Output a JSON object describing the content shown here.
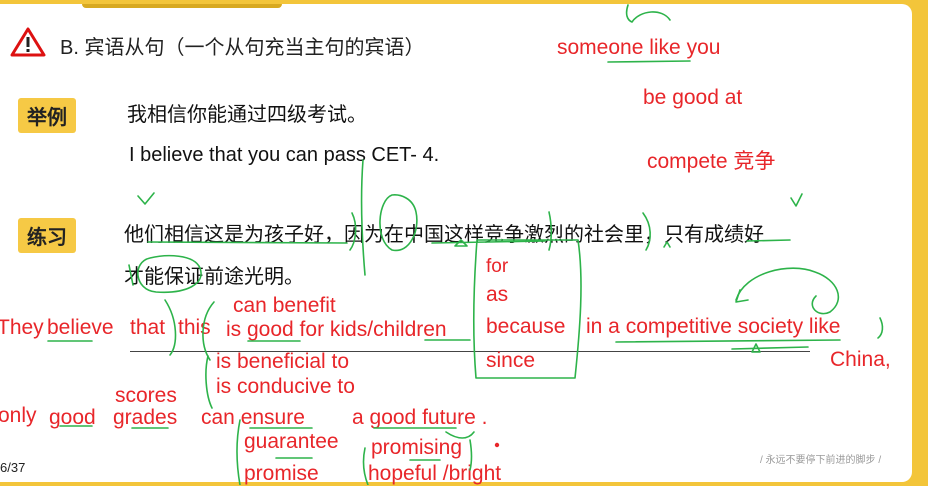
{
  "slide": {
    "heading": "B. 宾语从句（一个从句充当主句的宾语）",
    "example_tag": "举例",
    "example_cn": "我相信你能通过四级考试。",
    "example_en": "I believe that you can pass CET- 4.",
    "practice_tag": "练习",
    "practice_cn_line1": "他们相信这是为孩子好，因为在中国这样竞争激烈的社会里，只有成绩好",
    "practice_cn_line2": "才能保证前途光明。",
    "page_number": "6/37",
    "footer": "/ 永远不要停下前进的脚步 /"
  },
  "annotations": {
    "someone_like_you": "someone like you",
    "be_good_at": "be good at",
    "compete": "compete 竞争",
    "for": "for",
    "as": "as",
    "because": "because",
    "since": "since",
    "can_benefit": "can benefit",
    "they": "They",
    "believe": "believe",
    "that": "that",
    "this": "this",
    "is_good_for": "is good for kids/children",
    "in_competitive": "in a competitive society like",
    "china": "China,",
    "is_beneficial": "is beneficial to",
    "is_conducive": "is conducive to",
    "scores": "scores",
    "only": "only",
    "good": "good",
    "grades": "grades",
    "can_ensure": "can ensure",
    "a_good_future": "a good future .",
    "guarantee": "guarantee",
    "promising": "promising",
    "promise": "promise",
    "hopeful": "hopeful /bright"
  },
  "colors": {
    "frame": "#f3c53a",
    "tag": "#f6c945",
    "ink_red": "#e8262a",
    "ink_green": "#2db34a"
  }
}
